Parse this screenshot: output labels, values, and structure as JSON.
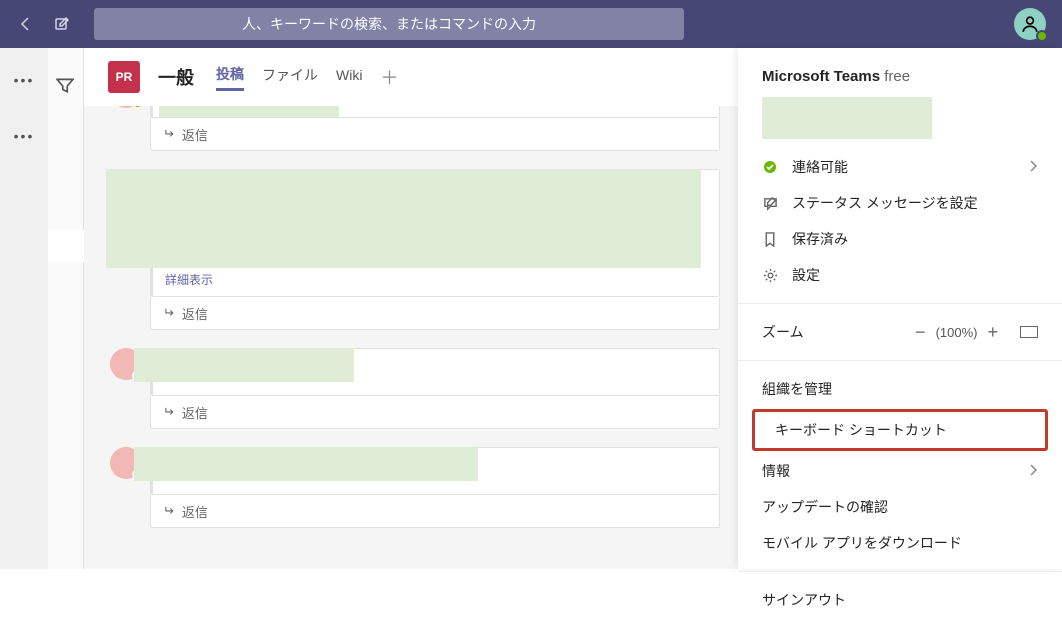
{
  "header": {
    "search_placeholder": "人、キーワードの検索、またはコマンドの入力"
  },
  "channel": {
    "team_initials": "PR",
    "name": "一般",
    "tabs": [
      {
        "label": "投稿",
        "active": true
      },
      {
        "label": "ファイル",
        "active": false
      },
      {
        "label": "Wiki",
        "active": false
      }
    ]
  },
  "conversation": {
    "reply_label": "返信",
    "show_more": "詳細表示"
  },
  "flyout": {
    "title_strong": "Microsoft Teams",
    "title_plan": "free",
    "presence_label": "連絡可能",
    "status_message": "ステータス メッセージを設定",
    "saved": "保存済み",
    "settings": "設定",
    "zoom_label": "ズーム",
    "zoom_pct": "(100%)",
    "manage_org": "組織を管理",
    "keyboard_shortcuts": "キーボード ショートカット",
    "info": "情報",
    "check_updates": "アップデートの確認",
    "download_mobile": "モバイル アプリをダウンロード",
    "sign_out": "サインアウト"
  }
}
